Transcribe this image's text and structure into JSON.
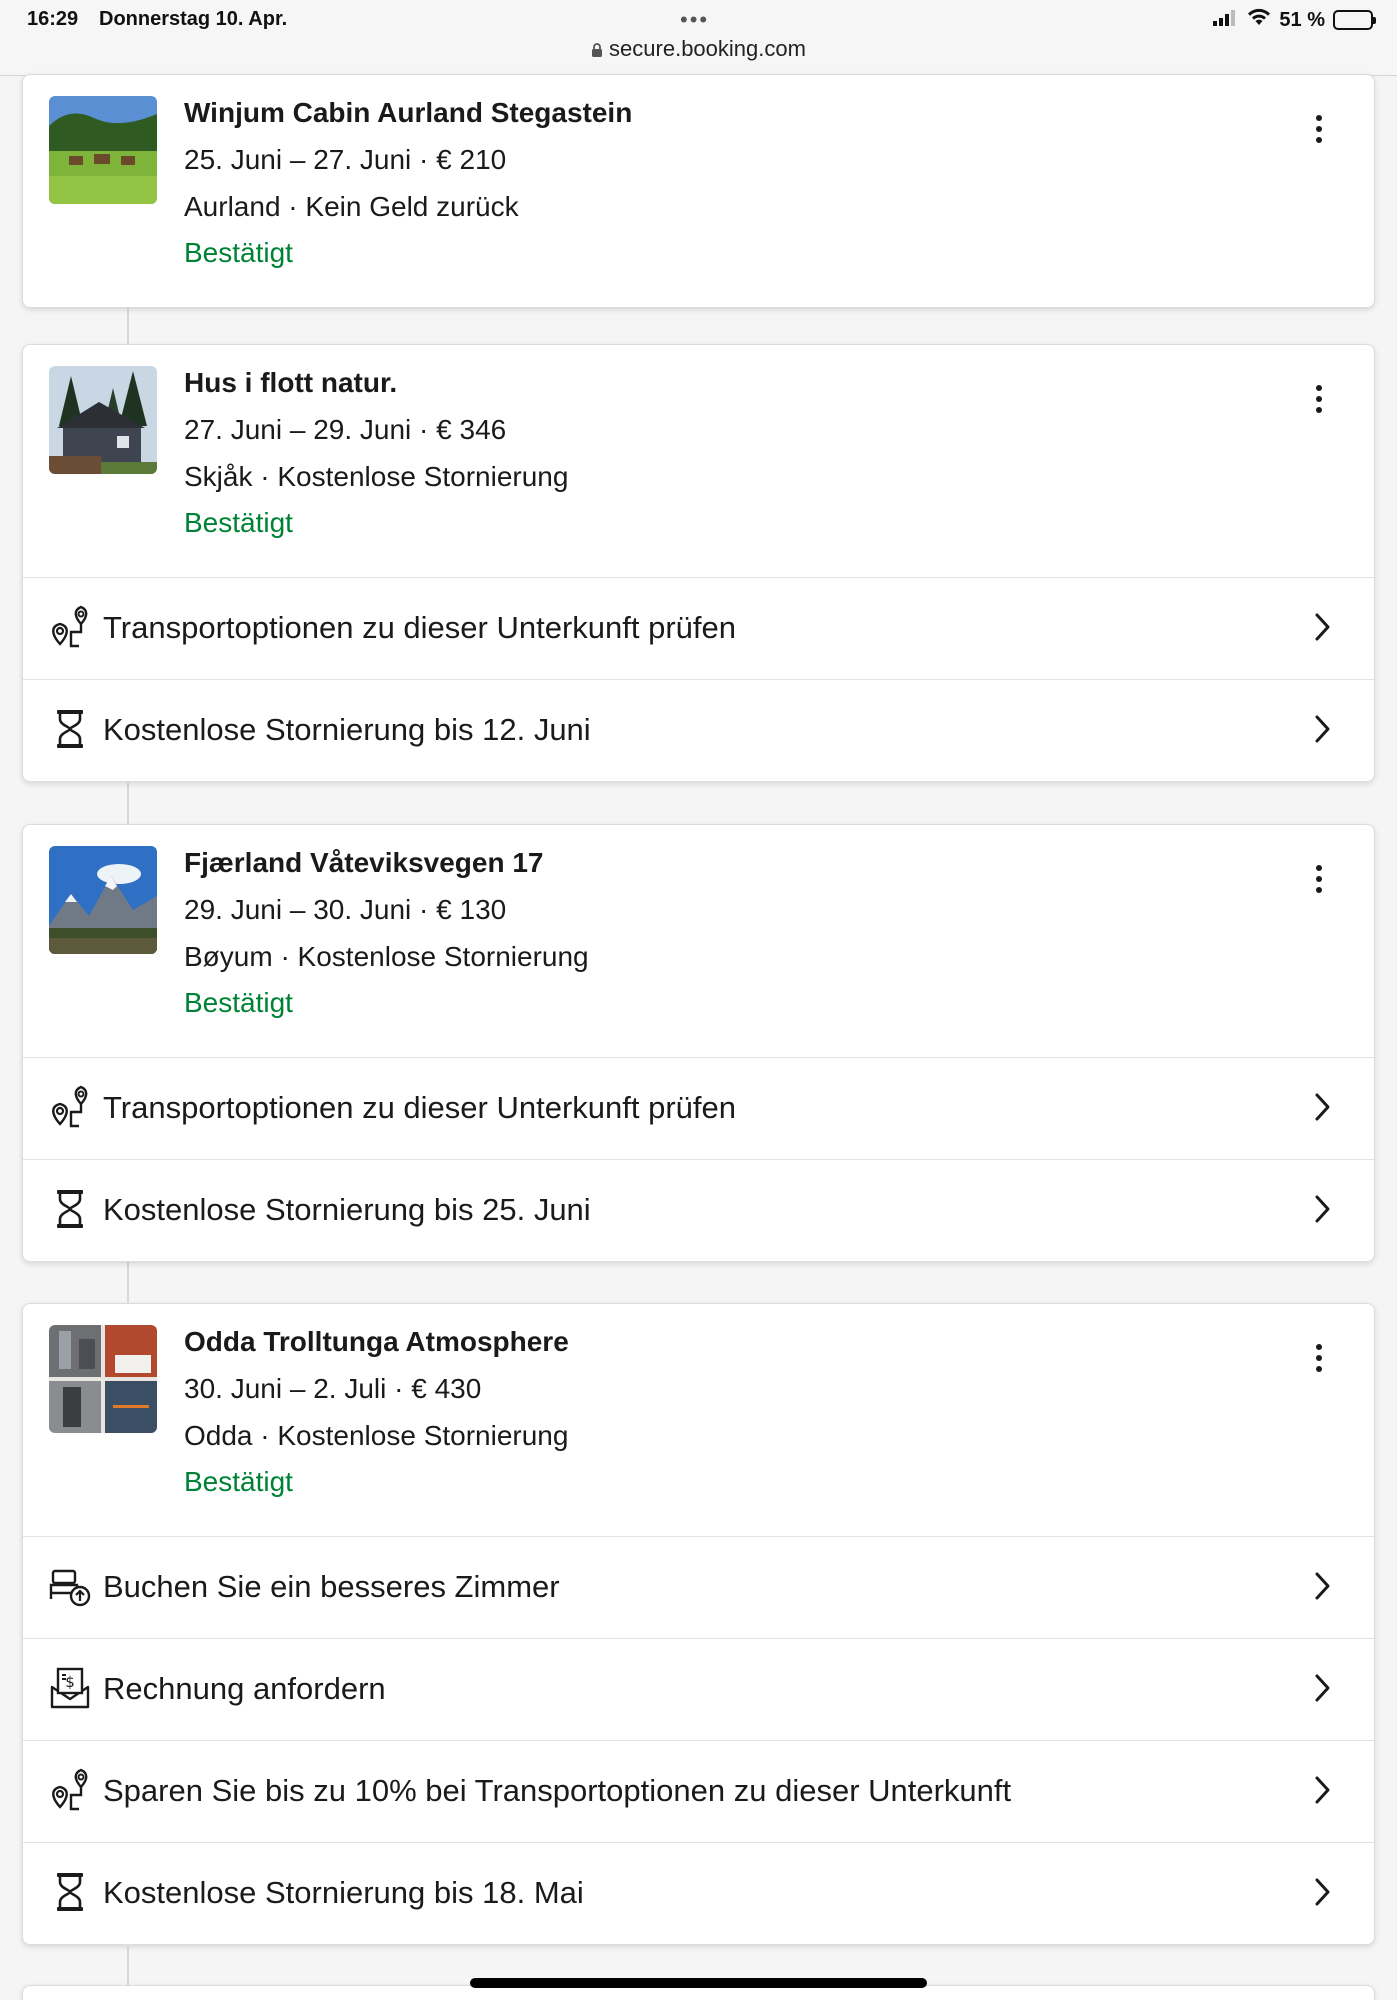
{
  "status_bar": {
    "time": "16:29",
    "date": "Donnerstag 10. Apr.",
    "url": "secure.booking.com",
    "battery": "51 %",
    "battery_level": 0.51
  },
  "colors": {
    "confirmed": "#008234",
    "text": "#1a1a1a",
    "divider": "#e2e2e2"
  },
  "bookings": [
    {
      "name": "Winjum Cabin Aurland Stegastein",
      "dates": "25. Juni – 27. Juni · € 210",
      "location": "Aurland · Kein Geld zurück",
      "status": "Bestätigt",
      "actions": []
    },
    {
      "name": "Hus i flott natur.",
      "dates": "27. Juni – 29. Juni · € 346",
      "location": "Skjåk · Kostenlose Stornierung",
      "status": "Bestätigt",
      "actions": [
        {
          "icon": "transport-pin-icon",
          "label": "Transportoptionen zu dieser Unterkunft prüfen"
        },
        {
          "icon": "hourglass-icon",
          "label": "Kostenlose Stornierung bis 12. Juni"
        }
      ]
    },
    {
      "name": "Fjærland Våteviksvegen 17",
      "dates": "29. Juni – 30. Juni · € 130",
      "location": "Bøyum · Kostenlose Stornierung",
      "status": "Bestätigt",
      "actions": [
        {
          "icon": "transport-pin-icon",
          "label": "Transportoptionen zu dieser Unterkunft prüfen"
        },
        {
          "icon": "hourglass-icon",
          "label": "Kostenlose Stornierung bis 25. Juni"
        }
      ]
    },
    {
      "name": "Odda Trolltunga Atmosphere",
      "dates": "30. Juni – 2. Juli · € 430",
      "location": "Odda · Kostenlose Stornierung",
      "status": "Bestätigt",
      "actions": [
        {
          "icon": "room-upgrade-icon",
          "label": "Buchen Sie ein besseres Zimmer"
        },
        {
          "icon": "invoice-icon",
          "label": "Rechnung anfordern"
        },
        {
          "icon": "transport-pin-icon",
          "label": "Sparen Sie bis zu 10% bei Transportoptionen zu dieser Unterkunft"
        },
        {
          "icon": "hourglass-icon",
          "label": "Kostenlose Stornierung bis 18. Mai"
        }
      ]
    }
  ]
}
